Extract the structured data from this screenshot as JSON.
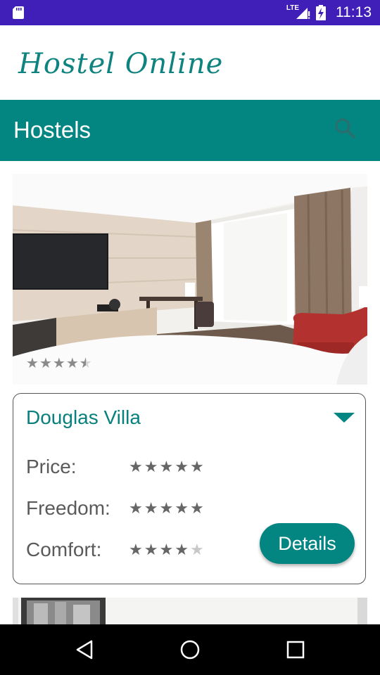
{
  "status_bar": {
    "network": "LTE",
    "time": "11:13",
    "icons": [
      "sd-card-icon",
      "signal-icon",
      "battery-charging-icon"
    ]
  },
  "app": {
    "title": "Hostel Online"
  },
  "toolbar": {
    "title": "Hostels",
    "search_icon": "search-icon"
  },
  "hostel_card": {
    "photo_rating": 4.5,
    "name": "Douglas Villa",
    "ratings": [
      {
        "label": "Price:",
        "stars": 5
      },
      {
        "label": "Freedom:",
        "stars": 5
      },
      {
        "label": "Comfort:",
        "stars": 4
      }
    ],
    "details_label": "Details"
  },
  "nav_bar": {
    "icons": [
      "back-icon",
      "home-icon",
      "recents-icon"
    ]
  },
  "colors": {
    "status_bar": "#3f1fb8",
    "primary": "#038682",
    "title_text": "#0f8380"
  }
}
